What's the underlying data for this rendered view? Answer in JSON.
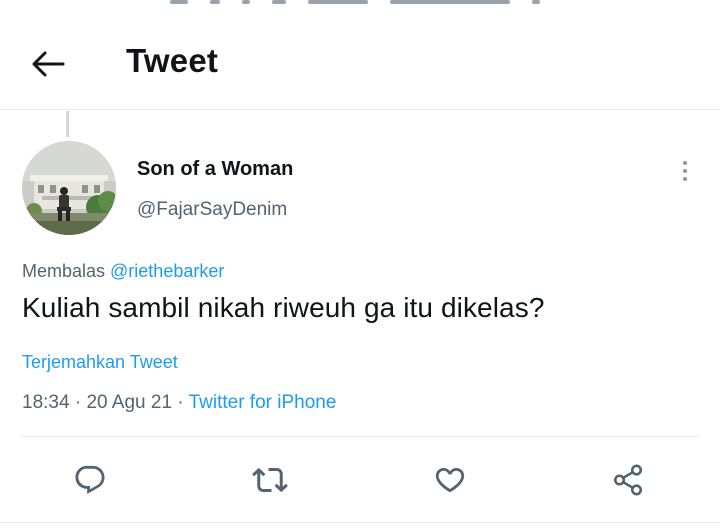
{
  "header": {
    "title": "Tweet"
  },
  "tweet": {
    "author_name": "Son of a Woman",
    "author_handle": "@FajarSayDenim",
    "reply_prefix": "Membalas ",
    "reply_to_handle": "@riethebarker",
    "text": "Kuliah sambil nikah riweuh ga itu dikelas?",
    "translate_label": "Terjemahkan Tweet",
    "time": "18:34",
    "date": "20 Agu 21",
    "source": "Twitter for iPhone"
  },
  "actions": [
    {
      "icon": "reply-icon"
    },
    {
      "icon": "retweet-icon"
    },
    {
      "icon": "like-icon"
    },
    {
      "icon": "share-icon"
    }
  ],
  "colors": {
    "link": "#1d9bf0",
    "secondary_text": "#536471",
    "primary_text": "#0f1419",
    "divider": "#e6e9eb"
  }
}
